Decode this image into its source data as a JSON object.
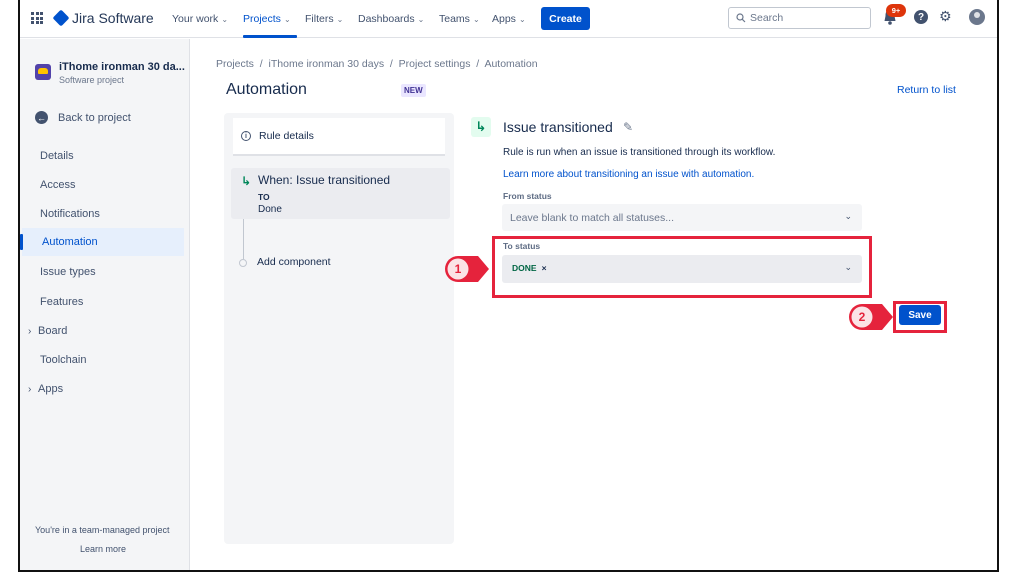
{
  "topnav": {
    "product": "Jira Software",
    "items": [
      {
        "label": "Your work"
      },
      {
        "label": "Projects"
      },
      {
        "label": "Filters"
      },
      {
        "label": "Dashboards"
      },
      {
        "label": "Teams"
      },
      {
        "label": "Apps"
      }
    ],
    "create_label": "Create",
    "search_placeholder": "Search",
    "notification_count": "9+"
  },
  "sidebar": {
    "project_name": "iThome ironman 30 da...",
    "project_type": "Software project",
    "back_label": "Back to project",
    "items": [
      {
        "label": "Details"
      },
      {
        "label": "Access"
      },
      {
        "label": "Notifications"
      },
      {
        "label": "Automation"
      },
      {
        "label": "Issue types"
      },
      {
        "label": "Features"
      },
      {
        "label": "Board"
      },
      {
        "label": "Toolchain"
      },
      {
        "label": "Apps"
      }
    ],
    "footer_text": "You're in a team-managed project",
    "footer_link": "Learn more"
  },
  "main": {
    "breadcrumb": "Projects  /  iThome ironman 30 days  /  Project settings  /  Automation",
    "title": "Automation",
    "badge": "NEW",
    "return_link": "Return to list"
  },
  "rule": {
    "details_label": "Rule details",
    "trigger_title": "When: Issue transitioned",
    "trigger_to": "TO",
    "trigger_value": "Done",
    "add_component": "Add component"
  },
  "config": {
    "title": "Issue transitioned",
    "description": "Rule is run when an issue is transitioned through its workflow.",
    "learn_link": "Learn more about transitioning an issue with automation.",
    "from_label": "From status",
    "from_placeholder": "Leave blank to match all statuses...",
    "to_label": "To status",
    "to_value": "DONE",
    "save_label": "Save"
  },
  "callouts": [
    "1",
    "2"
  ],
  "colors": {
    "accent": "#0052cc",
    "highlight": "#e5233c"
  }
}
